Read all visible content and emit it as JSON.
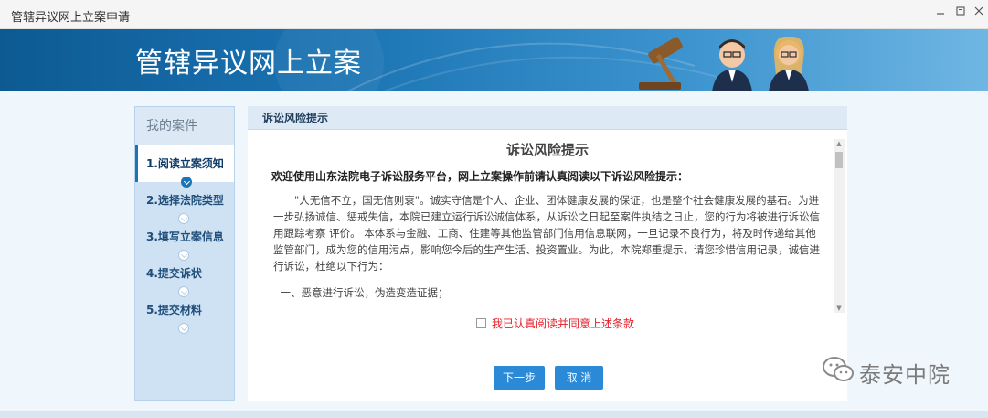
{
  "window": {
    "title": "管辖异议网上立案申请",
    "controls": [
      "minimize-icon",
      "maximize-icon",
      "close-icon"
    ]
  },
  "banner": {
    "heading": "管辖异议网上立案"
  },
  "sidebar": {
    "title": "我的案件",
    "steps": [
      {
        "label": "1.阅读立案须知",
        "active": true
      },
      {
        "label": "2.选择法院类型",
        "active": false
      },
      {
        "label": "3.填写立案信息",
        "active": false
      },
      {
        "label": "4.提交诉状",
        "active": false
      },
      {
        "label": "5.提交材料",
        "active": false
      }
    ]
  },
  "content": {
    "section_title": "诉讼风险提示",
    "doc_title": "诉讼风险提示",
    "intro": "欢迎使用山东法院电子诉讼服务平台，网上立案操作前请认真阅读以下诉讼风险提示：",
    "paragraph": "\"人无信不立，国无信则衰\"。诚实守信是个人、企业、团体健康发展的保证，也是整个社会健康发展的基石。为进一步弘扬诚信、惩戒失信，本院已建立运行诉讼诚信体系，从诉讼之日起至案件执结之日止，您的行为将被进行诉讼信用跟踪考察 评价。 本体系与金融、工商、住建等其他监管部门信用信息联网，一旦记录不良行为，将及时传递给其他监管部门，成为您的信用污点，影响您今后的生产生活、投资置业。为此，本院郑重提示，请您珍惜信用记录，诚信进行诉讼，杜绝以下行为：",
    "item1": "一、恶意进行诉讼，伪造变造证据；",
    "agree_label": "我已认真阅读并同意上述条款",
    "agree_checked": false,
    "next_button": "下一步",
    "cancel_button": "取 消"
  },
  "watermark": {
    "text": "泰安中院",
    "icon": "wechat-icon"
  },
  "colors": {
    "banner": "#1b74b3",
    "button": "#2b8ad8",
    "agree_text": "#e5212b",
    "sidebar": "#cfe2f3"
  }
}
